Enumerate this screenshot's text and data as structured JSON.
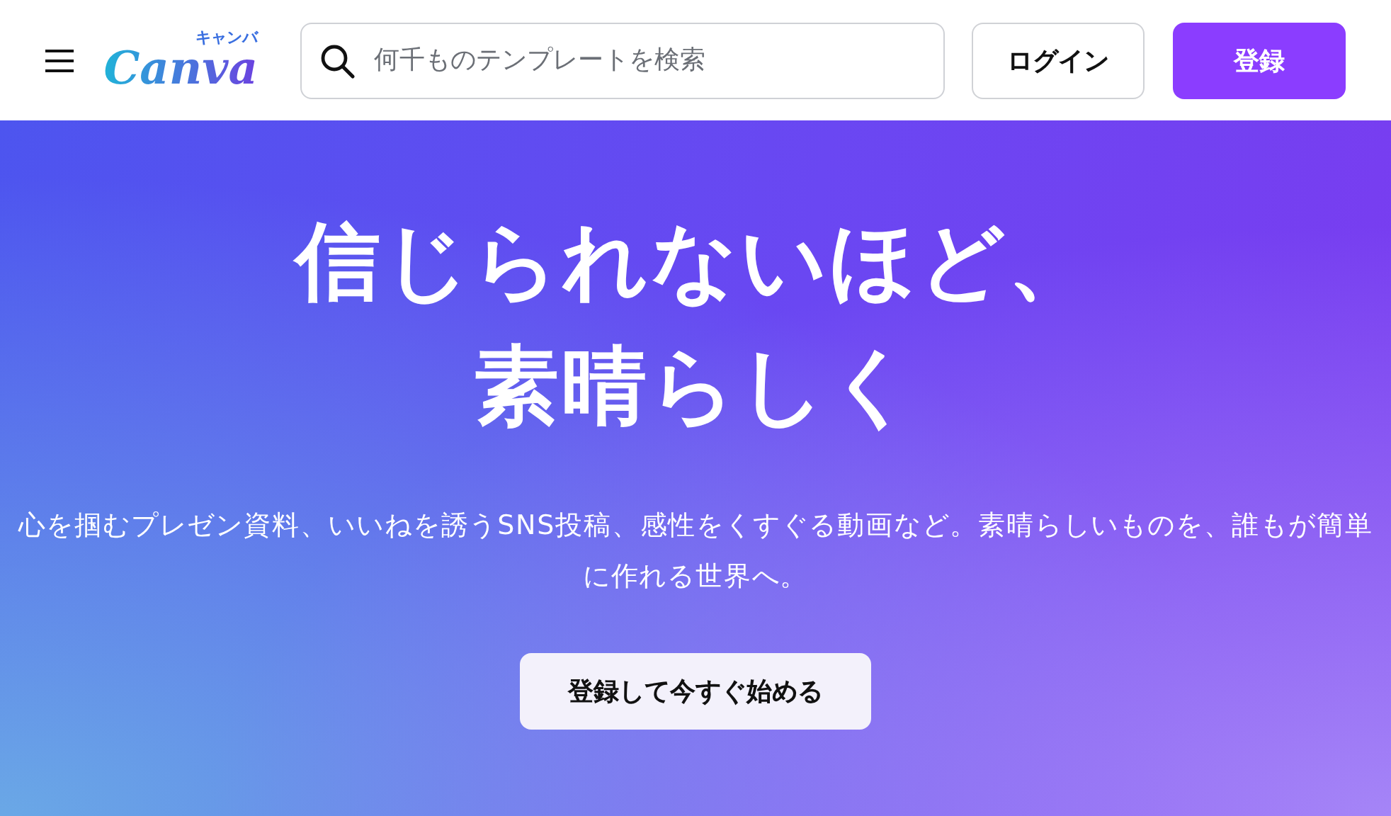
{
  "header": {
    "logo": {
      "wordmark": "Canva",
      "kana": "キャンバ"
    },
    "search": {
      "placeholder": "何千ものテンプレートを検索"
    },
    "buttons": [
      {
        "label": "ログイン",
        "kind": "secondary"
      },
      {
        "label": "登録",
        "kind": "primary"
      }
    ]
  },
  "hero": {
    "title_lines": [
      "信じられないほど、",
      "素晴らしく"
    ],
    "subtitle": "心を掴むプレゼン資料、いいねを誘うSNS投稿、感性をくすぐる動画など。素晴らしいものを、誰もが簡単に作れる世界へ。",
    "cta": "登録して今すぐ始める"
  }
}
